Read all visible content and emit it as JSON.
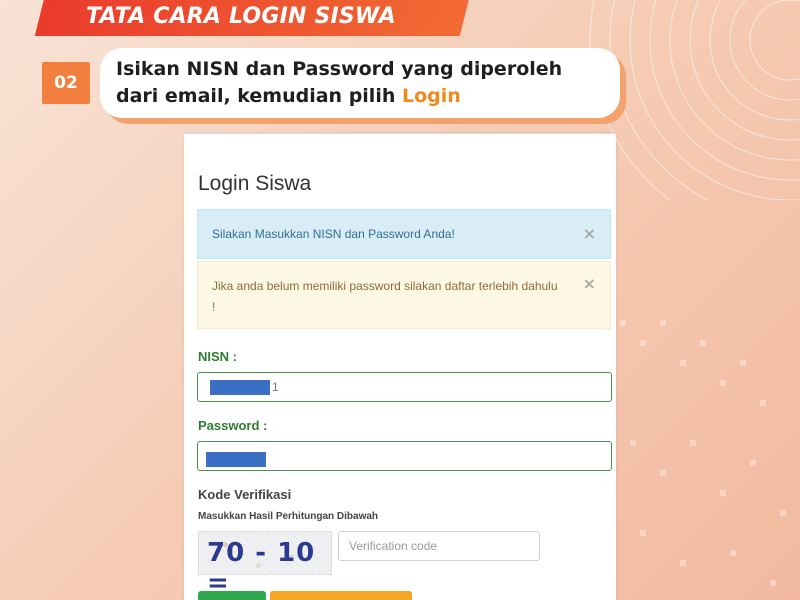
{
  "banner": {
    "title": "TATA CARA LOGIN SISWA"
  },
  "step": {
    "number": "02",
    "line1": "Isikan NISN dan Password yang diperoleh",
    "line2_prefix": "dari email, kemudian pilih ",
    "line2_highlight": "Login"
  },
  "form": {
    "title": "Login Siswa",
    "alert_info": "Silakan Masukkan NISN dan Password Anda!",
    "alert_warning": "Jika anda belum memiliki password silakan daftar terlebih dahulu !",
    "close_glyph": "×",
    "nisn_label": "NISN :",
    "nisn_value_visible": "1",
    "password_label": "Password :",
    "kode_label": "Kode Verifikasi",
    "kode_sub": "Masukkan Hasil Perhitungan Dibawah",
    "captcha_text": "70 - 10 =",
    "verification_placeholder": "Verification code"
  },
  "colors": {
    "banner": "#ea3b2c",
    "step_badge": "#f37f3f",
    "highlight": "#f08a1c",
    "label_green": "#2e7d32",
    "info_bg": "#d9edf7",
    "warning_bg": "#fcf8e3",
    "button_green": "#2fa84f",
    "button_orange": "#f5a623"
  },
  "icons": {
    "alert_close": "close-icon"
  }
}
